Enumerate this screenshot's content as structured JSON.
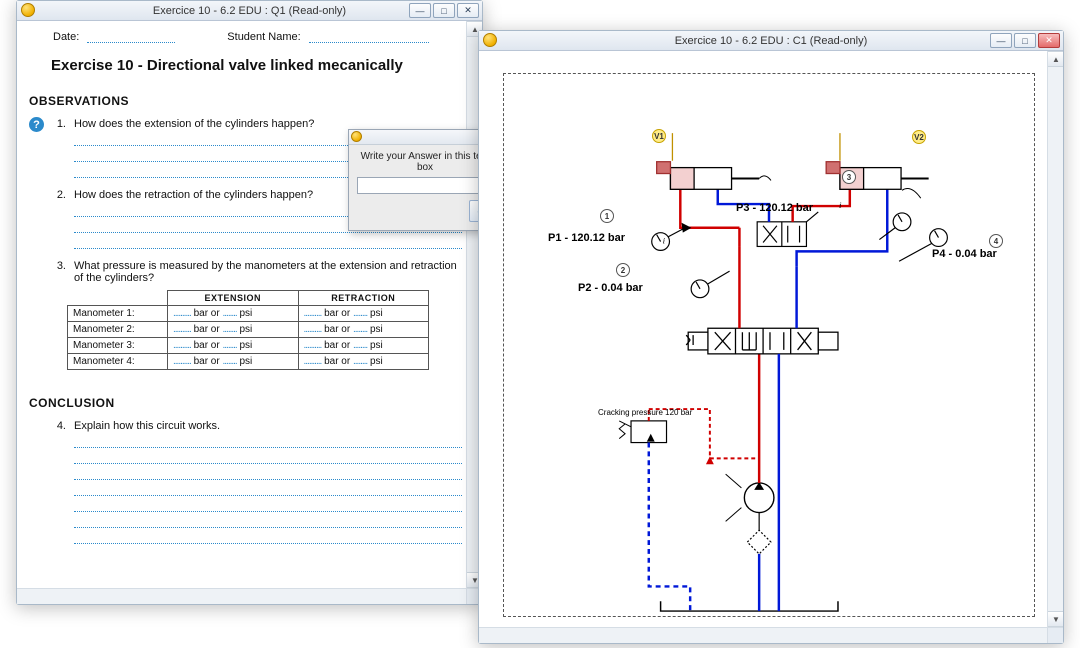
{
  "win1": {
    "title": "Exercice 10 - 6.2 EDU : Q1 (Read-only)",
    "date_label": "Date:",
    "name_label": "Student Name:",
    "exercise_title": "Exercise 10 -  Directional valve linked mecanically",
    "observations_heading": "OBSERVATIONS",
    "q1_num": "1.",
    "q1_text": "How does the extension of the cylinders happen?",
    "q2_num": "2.",
    "q2_text": "How does the retraction of the cylinders happen?",
    "q3_num": "3.",
    "q3_text": "What pressure is measured by the manometers at the extension and retraction of the cylinders?",
    "table": {
      "h_ext": "EXTENSION",
      "h_ret": "RETRACTION",
      "rows": [
        "Manometer 1:",
        "Manometer 2:",
        "Manometer 3:",
        "Manometer 4:"
      ],
      "cell": "bar   or",
      "unit": "psi"
    },
    "conclusion_heading": "CONCLUSION",
    "q4_num": "4.",
    "q4_text": "Explain how this circuit works.",
    "popup": {
      "prompt": "Write your Answer in this text box",
      "ok": "✓"
    }
  },
  "win2": {
    "title": "Exercice 10 - 6.2 EDU : C1 (Read-only)",
    "labels": {
      "p1": "P1 - 120.12 bar",
      "p2": "P2 - 0.04 bar",
      "p3": "P3 - 120.12 bar",
      "p4": "P4 - 0.04 bar",
      "crack": "Cracking pressure 120 bar",
      "v1": "V1",
      "v2": "V2",
      "n1": "1",
      "n2": "2",
      "n3": "3",
      "n4": "4"
    }
  },
  "icons": {
    "min": "—",
    "max": "□",
    "close": "✕",
    "up": "▲",
    "down": "▼"
  }
}
